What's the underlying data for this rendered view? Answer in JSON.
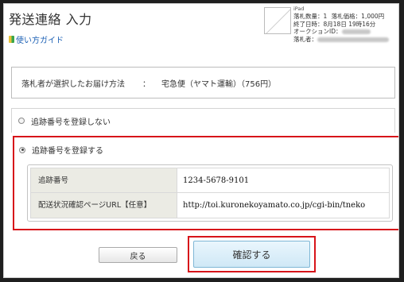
{
  "page": {
    "title": "発送連絡 入力",
    "guide_link": "使い方ガイド"
  },
  "item": {
    "model": "iPad",
    "quantity_label": "落札数量：",
    "quantity": "1",
    "price_label": "落札価格：",
    "price": "1,000円",
    "end_label": "終了日時：",
    "end": "8月18日 19時16分",
    "auction_id_label": "オークションID：",
    "winner_label": "落札者："
  },
  "delivery": {
    "label": "落札者が選択したお届け方法",
    "separator": "：",
    "value": "宅急便（ヤマト運輸）（756円）"
  },
  "options": {
    "no_register": "追跡番号を登録しない",
    "register": "追跡番号を登録する",
    "selected": "register"
  },
  "tracking": {
    "number_label": "追跡番号",
    "number_value": "1234-5678-9101",
    "url_label": "配送状況確認ページURL【任意】",
    "url_value": "http://toi.kuronekoyamato.co.jp/cgi-bin/tneko"
  },
  "buttons": {
    "back": "戻る",
    "confirm": "確認する"
  },
  "colors": {
    "highlight": "#d7141a",
    "link": "#1a5fb4",
    "confirm_bg": "#cfe8f6",
    "label_bg": "#ebebe4"
  }
}
